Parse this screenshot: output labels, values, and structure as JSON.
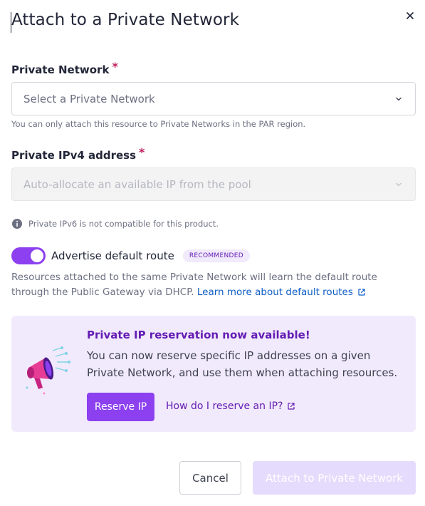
{
  "dialog": {
    "title": "Attach to a Private Network",
    "close_icon": "close-icon"
  },
  "private_network": {
    "label": "Private Network",
    "required_mark": "*",
    "placeholder": "Select a Private Network",
    "help": "You can only attach this resource to Private Networks in the PAR region."
  },
  "ipv4": {
    "label": "Private IPv4 address",
    "required_mark": "*",
    "placeholder": "Auto-allocate an available IP from the pool"
  },
  "ipv6_info": {
    "icon": "info-icon",
    "text": "Private IPv6 is not compatible for this product."
  },
  "default_route": {
    "toggle_on": true,
    "label": "Advertise default route",
    "badge": "RECOMMENDED",
    "description": "Resources attached to the same Private Network will learn the default route through the Public Gateway via DHCP.",
    "link_label": "Learn more about default routes"
  },
  "promo": {
    "icon": "megaphone-icon",
    "title": "Private IP reservation now available!",
    "text": "You can now reserve specific IP addresses on a given Private Network, and use them when attaching resources.",
    "button_label": "Reserve IP",
    "link_label": "How do I reserve an IP?"
  },
  "footer": {
    "cancel_label": "Cancel",
    "submit_label": "Attach to Private Network"
  },
  "colors": {
    "accent": "#8c40ef",
    "accent_dark": "#641cb3",
    "promo_bg": "#f1eafc",
    "link": "#0e5dc6",
    "required": "#c01c5c"
  }
}
